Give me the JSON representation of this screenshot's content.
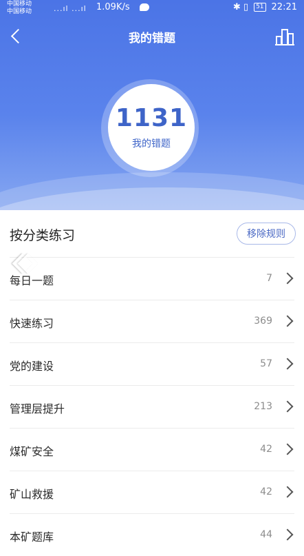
{
  "status": {
    "carrier1": "中国移动",
    "carrier2": "中国移动",
    "signal": "...ıl ...ıl",
    "speed": "1.09K/s",
    "indicators": "✱ ▯ ",
    "battery": "51",
    "time": "22:21"
  },
  "nav": {
    "title": "我的错题"
  },
  "summary": {
    "count": "1131",
    "label": "我的错题"
  },
  "section": {
    "title": "按分类练习",
    "remove_rule_label": "移除规则"
  },
  "categories": [
    {
      "label": "每日一题",
      "count": "7"
    },
    {
      "label": "快速练习",
      "count": "369"
    },
    {
      "label": "党的建设",
      "count": "57"
    },
    {
      "label": "管理层提升",
      "count": "213"
    },
    {
      "label": "煤矿安全",
      "count": "42"
    },
    {
      "label": "矿山救援",
      "count": "42"
    },
    {
      "label": "本矿题库",
      "count": "44"
    }
  ],
  "colors": {
    "header_top": "#4b74e6",
    "accent": "#3e64c8"
  }
}
